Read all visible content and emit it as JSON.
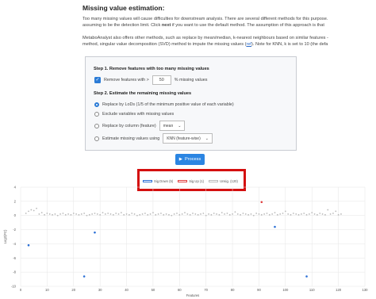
{
  "page": {
    "title": "Missing value estimation:",
    "intro1": "Too many missing values will cause difficulties for downstream analysis. There are several different methods for this purpose.",
    "intro2_pre": "assuming to be the detection limit. Click ",
    "intro2_bold": "next",
    "intro2_post": " if you want to use the default method. The assumption of this approach is that",
    "intro3": "MetaboAnalyst also offers other methods, such as replace by mean/median, k-nearest neighbours based on similar features -",
    "intro4_pre": "method, singular value decomposition (SVD) method to impute the missing values (",
    "intro4_link": "ref",
    "intro4_post": "). Note for KNN, k is set to 10 (the defa"
  },
  "panel": {
    "step1": "Step 1. Remove features with too many missing values",
    "remove_label": "Remove features with >",
    "remove_value": "50",
    "remove_unit": "% missing values",
    "step2": "Step 2. Estimate the remaining missing values",
    "options": [
      "Replace by LoDs (1/5 of the minimum positive value of each variable)",
      "Exclude variables with missing values",
      "Replace by column (feature)",
      "Estimate missing values using"
    ],
    "column_select": "mean",
    "estimate_select": "KNN (feature-wise)",
    "process_button": "Process"
  },
  "legend": [
    "Sig.Down (5)",
    "Sig.Up (1)",
    "Unsig. (120)"
  ],
  "colors": {
    "down": "#2a6fd6",
    "up": "#e04040",
    "unsig": "#bbbbbb",
    "accent": "#2b85e2",
    "highlight": "#d40f0f"
  },
  "chart_data": {
    "type": "scatter",
    "xlabel": "Features",
    "ylabel": "Log2(FC)",
    "xlim": [
      0,
      130
    ],
    "ylim": [
      -10,
      4
    ],
    "xticks": [
      0,
      10,
      20,
      30,
      40,
      50,
      60,
      70,
      80,
      90,
      100,
      110,
      120,
      130
    ],
    "yticks": [
      4,
      2,
      0,
      -2,
      -4,
      -6,
      -8,
      -10
    ],
    "grid": true,
    "series": [
      {
        "name": "Sig.Down (5)",
        "points": [
          [
            3,
            -4.2
          ],
          [
            24,
            -8.6
          ],
          [
            28,
            -2.4
          ],
          [
            96,
            -1.6
          ],
          [
            108,
            -8.6
          ]
        ]
      },
      {
        "name": "Sig.Up (1)",
        "points": [
          [
            91,
            1.9
          ]
        ]
      },
      {
        "name": "Unsig. (120)",
        "values": [
          0.3,
          0.6,
          0.8,
          0.7,
          1.0,
          0.2,
          0.4,
          0.1,
          0.3,
          0.2,
          0.1,
          0.2,
          0.0,
          0.2,
          0.3,
          0.1,
          0.2,
          0.1,
          0.3,
          0.2,
          0.1,
          0.2,
          0.3,
          0.0,
          0.1,
          0.2,
          0.3,
          0.2,
          0.1,
          0.4,
          0.2,
          0.3,
          0.2,
          0.1,
          0.3,
          0.2,
          0.4,
          0.1,
          0.2,
          0.1,
          0.3,
          0.2,
          0.0,
          0.1,
          0.2,
          0.3,
          0.1,
          0.2,
          0.4,
          0.1,
          0.2,
          0.3,
          0.1,
          0.2,
          0.1,
          0.0,
          0.2,
          0.3,
          0.1,
          0.2,
          0.4,
          0.2,
          0.1,
          0.3,
          0.2,
          0.1,
          0.2,
          0.3,
          0.0,
          0.2,
          0.1,
          0.3,
          0.2,
          0.1,
          0.4,
          0.2,
          0.3,
          0.1,
          0.2,
          0.5,
          0.2,
          0.1,
          0.3,
          0.2,
          0.1,
          0.2,
          0.0,
          0.3,
          0.2,
          0.1,
          0.2,
          0.3,
          0.1,
          0.2,
          0.4,
          0.1,
          0.2,
          0.3,
          0.6,
          0.2,
          0.1,
          0.3,
          0.2,
          0.1,
          0.2,
          0.3,
          0.1,
          0.2,
          0.4,
          0.2,
          0.1,
          0.3,
          0.2,
          0.1,
          0.8,
          0.2,
          0.3,
          0.6,
          0.1,
          0.2
        ]
      }
    ]
  }
}
